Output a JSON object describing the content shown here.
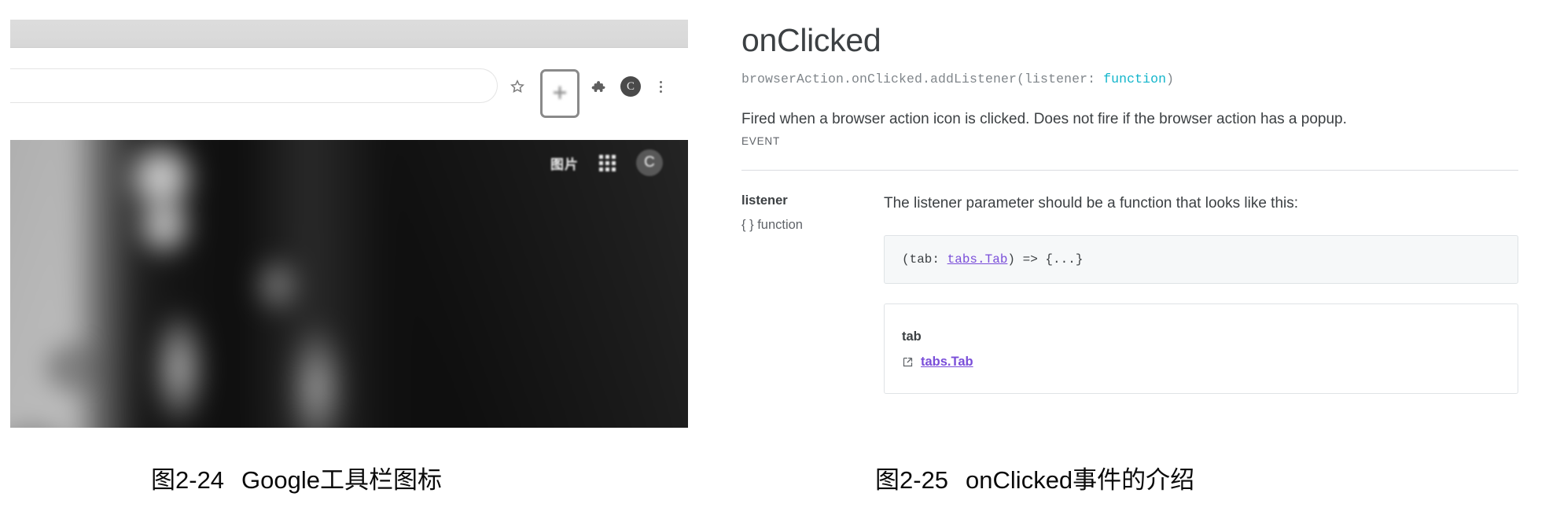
{
  "figure_left": {
    "caption_number": "图2-24",
    "caption_text": "Google工具栏图标",
    "browser_toolbar": {
      "bookmark_icon": "star-icon",
      "highlighted_extension_icon": "extension-action-icon",
      "extensions_icon": "puzzle-piece-icon",
      "profile_avatar_label": "C",
      "menu_icon": "three-dot-menu-icon"
    },
    "page_header": {
      "images_link_label": "图片",
      "apps_icon": "apps-grid-icon",
      "account_avatar_label": "C"
    }
  },
  "figure_right": {
    "caption_number": "图2-25",
    "caption_text": "onClicked事件的介绍",
    "doc": {
      "title": "onClicked",
      "signature_prefix": "browserAction.onClicked.addListener(listener: ",
      "signature_keyword": "function",
      "signature_suffix": ")",
      "description": "Fired when a browser action icon is clicked. Does not fire if the browser action has a popup.",
      "kind_label": "EVENT",
      "parameter": {
        "name": "listener",
        "type": "{ } function",
        "description": "The listener parameter should be a function that looks like this:",
        "code_prefix": "(tab: ",
        "code_link": "tabs.Tab",
        "code_suffix": ") => {...}",
        "subcard": {
          "name": "tab",
          "type_link": "tabs.Tab",
          "external_link_icon": "external-link-icon"
        }
      }
    }
  },
  "colors": {
    "text_primary": "#3c4043",
    "text_secondary": "#5f6368",
    "keyword_teal": "#12b5cb",
    "link_purple": "#7a4ed9",
    "border_gray": "#dadce0",
    "code_bg": "#f6f8f9"
  }
}
